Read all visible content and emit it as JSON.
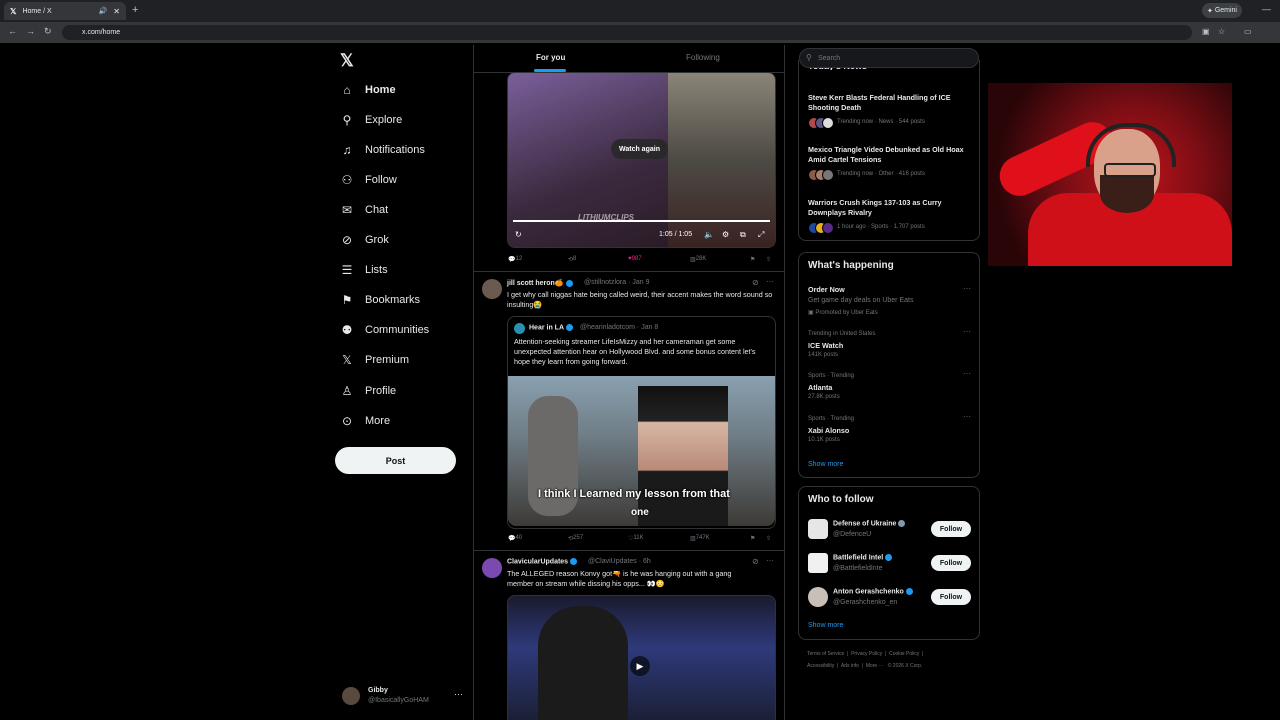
{
  "browser": {
    "tab_title": "Home / X",
    "tab_icon": "x-logo",
    "url": "x.com/home",
    "gemini_label": "Gemini"
  },
  "nav": {
    "items": [
      {
        "label": "Home",
        "icon": "home-icon"
      },
      {
        "label": "Explore",
        "icon": "search-icon"
      },
      {
        "label": "Notifications",
        "icon": "bell-icon"
      },
      {
        "label": "Follow",
        "icon": "follow-icon"
      },
      {
        "label": "Chat",
        "icon": "mail-icon"
      },
      {
        "label": "Grok",
        "icon": "grok-icon"
      },
      {
        "label": "Lists",
        "icon": "list-icon"
      },
      {
        "label": "Bookmarks",
        "icon": "bookmark-icon"
      },
      {
        "label": "Communities",
        "icon": "communities-icon"
      },
      {
        "label": "Premium",
        "icon": "x-icon"
      },
      {
        "label": "Profile",
        "icon": "profile-icon"
      },
      {
        "label": "More",
        "icon": "more-icon"
      }
    ],
    "post_label": "Post",
    "user": {
      "name": "Gibby",
      "handle": "@IbasicallyGoHAM"
    }
  },
  "feed": {
    "tabs": [
      "For you",
      "Following"
    ],
    "video1": {
      "watch_again": "Watch again",
      "time": "1:05 / 1:05",
      "overlay_text": "LITHIUMCLIPS",
      "actions": {
        "replies": "12",
        "reposts": "8",
        "likes": "987",
        "views": "28K"
      }
    },
    "tweet2": {
      "name": "jill scott heron🍊",
      "handle": "@stillnotzlora",
      "time": "· Jan 9",
      "text": "I get why call niggas hate being called weird, their accent makes the word sound so insulting😭",
      "quote": {
        "name": "Hear in LA",
        "handle": "@hearinladotcom",
        "time": "· Jan 8",
        "text": "Attention-seeking streamer LifeIsMizzy and her cameraman get some unexpected attention hear on Hollywood Blvd. and some bonus content let's hope they learn from going forward.",
        "caption": "I think I Learned my lesson from that",
        "caption2": "one"
      },
      "actions": {
        "replies": "40",
        "reposts": "257",
        "likes": "11K",
        "views": "747K"
      }
    },
    "tweet3": {
      "name": "ClavicularUpdates",
      "handle": "@ClaviUpdates",
      "time": "· 6h",
      "text": "The ALLEGED reason Konvy got🔫 is he was hanging out with a gang member on stream while dissing his opps... 👀😳"
    }
  },
  "sidebar": {
    "search_placeholder": "Search",
    "news_heading": "Today's News",
    "news": [
      {
        "title": "Steve Kerr Blasts Federal Handling of ICE Shooting Death",
        "meta": "Trending now · News · 544 posts"
      },
      {
        "title": "Mexico Triangle Video Debunked as Old Hoax Amid Cartel Tensions",
        "meta": "Trending now · Other · 416 posts"
      },
      {
        "title": "Warriors Crush Kings 137-103 as Curry Downplays Rivalry",
        "meta": "1 hour ago · Sports · 1,707 posts"
      }
    ],
    "happening": {
      "title": "What's happening",
      "items": [
        {
          "small": "",
          "main": "Order Now",
          "sub": "Get game day deals on Uber Eats",
          "promo": "Promoted by Uber Eats"
        },
        {
          "small": "Trending in United States",
          "main": "ICE Watch",
          "sub": "141K posts"
        },
        {
          "small": "Sports · Trending",
          "main": "Atlanta",
          "sub": "27.8K posts"
        },
        {
          "small": "Sports · Trending",
          "main": "Xabi Alonso",
          "sub": "10.1K posts"
        }
      ],
      "show_more": "Show more"
    },
    "who_to_follow": {
      "title": "Who to follow",
      "accounts": [
        {
          "name": "Defense of Ukraine",
          "handle": "@DefenceU",
          "button": "Follow"
        },
        {
          "name": "Battlefield Intel",
          "handle": "@BattlefieldInte",
          "button": "Follow"
        },
        {
          "name": "Anton Gerashchenko",
          "handle": "@Gerashchenko_en",
          "button": "Follow"
        }
      ],
      "show_more": "Show more"
    },
    "footer": [
      "Terms of Service",
      "Privacy Policy",
      "Cookie Policy",
      "Accessibility",
      "Ads info",
      "More ···",
      "© 2026 X Corp."
    ]
  },
  "colors": {
    "accent": "#1d9bf0",
    "like": "#f91880",
    "background": "#000000"
  }
}
